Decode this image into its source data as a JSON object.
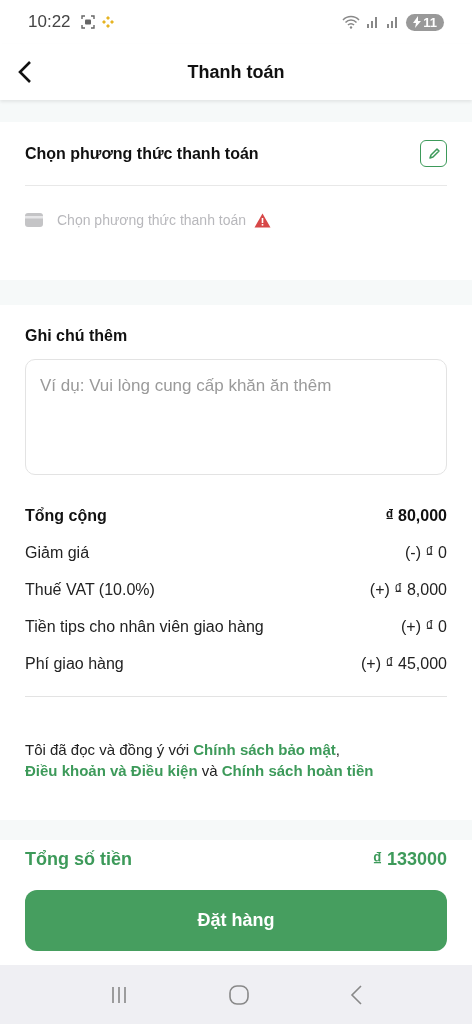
{
  "status_bar": {
    "time": "10:22",
    "battery": "11"
  },
  "header": {
    "title": "Thanh toán"
  },
  "payment": {
    "heading": "Chọn phương thức thanh toán",
    "placeholder": "Chọn phương thức thanh toán"
  },
  "notes": {
    "label": "Ghi chú thêm",
    "placeholder": "Ví dụ: Vui lòng cung cấp khăn ăn thêm"
  },
  "summary": [
    {
      "kind": "total",
      "label": "Tổng cộng",
      "value": "₫ 80,000"
    },
    {
      "kind": "item",
      "label": "Giảm giá",
      "value": "(-) ₫ 0"
    },
    {
      "kind": "item",
      "label": "Thuế VAT  (10.0%)",
      "value": "(+) ₫ 8,000"
    },
    {
      "kind": "item",
      "label": "Tiền tips cho nhân viên giao hàng",
      "value": "(+) ₫ 0"
    },
    {
      "kind": "item",
      "label": "Phí giao hàng",
      "value": "(+) ₫ 45,000"
    }
  ],
  "agreement": [
    {
      "kind": "text",
      "text": "Tôi đã đọc và đồng ý với"
    },
    {
      "kind": "link",
      "text": "Chính sách bảo mật"
    },
    {
      "kind": "text",
      "text": ","
    },
    {
      "kind": "link",
      "text": "Điều khoản và Điều kiện"
    },
    {
      "kind": "text",
      "text": "và"
    },
    {
      "kind": "link",
      "text": "Chính sách hoàn tiền"
    }
  ],
  "footer": {
    "total_label": "Tổng số tiền",
    "total_value": "₫ 133000",
    "button": "Đặt hàng"
  }
}
